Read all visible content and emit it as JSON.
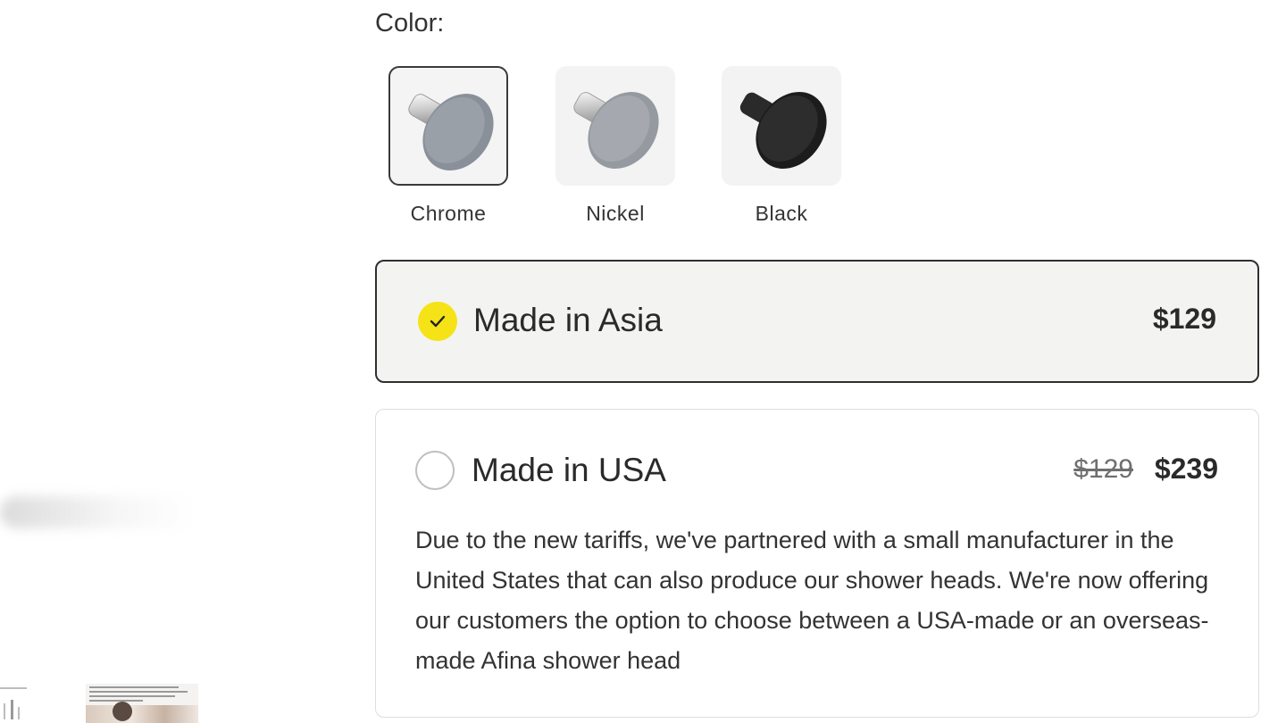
{
  "color_selector": {
    "label": "Color:",
    "options": [
      {
        "name": "Chrome",
        "selected": true,
        "icon": "shower-head-chrome-icon"
      },
      {
        "name": "Nickel",
        "selected": false,
        "icon": "shower-head-nickel-icon"
      },
      {
        "name": "Black",
        "selected": false,
        "icon": "shower-head-black-icon"
      }
    ]
  },
  "origin_options": [
    {
      "title": "Made in Asia",
      "price": "$129",
      "selected": true
    },
    {
      "title": "Made in USA",
      "original_price": "$129",
      "price": "$239",
      "selected": false,
      "description": "Due to the new tariffs, we've partnered with a small manufacturer in the United States that can also produce our shower heads. We're now offering our customers the option to choose between a USA-made or an overseas-made Afina shower head"
    }
  ],
  "colors": {
    "selected_check": "#f5e317",
    "selected_card_bg": "#f3f3f1",
    "selected_border": "#2f2f2f"
  }
}
